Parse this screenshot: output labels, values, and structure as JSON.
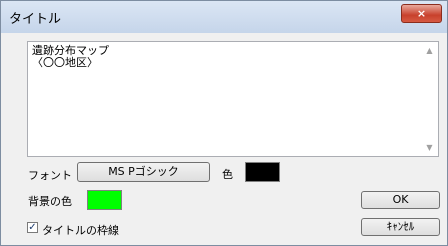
{
  "window": {
    "title": "タイトル",
    "close_glyph": "×"
  },
  "text_area": {
    "lines": "遺跡分布マップ\n〈〇〇地区〉",
    "scroll_up_glyph": "▲",
    "scroll_down_glyph": "▼"
  },
  "font_row": {
    "label": "フォント",
    "font_value": "MS Pゴシック",
    "color_label": "色",
    "color_value": "#000000"
  },
  "background_row": {
    "label": "背景の色",
    "color_value": "#00ff00"
  },
  "frame_option": {
    "label": "タイトルの枠線",
    "checked": true,
    "check_glyph": "✓"
  },
  "buttons": {
    "ok": "OK",
    "cancel": "ｷｬﾝｾﾙ"
  }
}
